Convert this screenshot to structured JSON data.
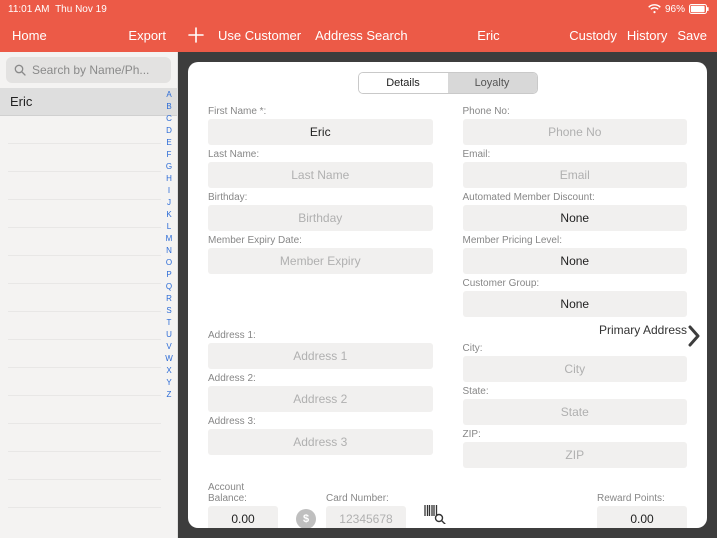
{
  "status": {
    "time": "11:01 AM",
    "date": "Thu Nov 19",
    "battery": "96%"
  },
  "toolbar": {
    "home": "Home",
    "export": "Export",
    "use_customer": "Use Customer",
    "address_search": "Address Search",
    "title": "Eric",
    "custody": "Custody",
    "history": "History",
    "save": "Save"
  },
  "sidebar": {
    "search_placeholder": "Search by Name/Ph...",
    "items": [
      "Eric"
    ],
    "az": [
      "A",
      "B",
      "C",
      "D",
      "E",
      "F",
      "G",
      "H",
      "I",
      "J",
      "K",
      "L",
      "M",
      "N",
      "O",
      "P",
      "Q",
      "R",
      "S",
      "T",
      "U",
      "V",
      "W",
      "X",
      "Y",
      "Z"
    ]
  },
  "tabs": {
    "details": "Details",
    "loyalty": "Loyalty"
  },
  "labels": {
    "first_name": "First Name *:",
    "last_name": "Last Name:",
    "birthday": "Birthday:",
    "member_expiry": "Member Expiry Date:",
    "phone": "Phone No:",
    "email": "Email:",
    "auto_discount": "Automated Member Discount:",
    "pricing_level": "Member Pricing Level:",
    "customer_group": "Customer Group:",
    "primary_address": "Primary Address",
    "address1": "Address 1:",
    "address2": "Address 2:",
    "address3": "Address 3:",
    "city": "City:",
    "state": "State:",
    "zip": "ZIP:",
    "account_balance": "Account Balance:",
    "card_number": "Card Number:",
    "reward_points": "Reward Points:"
  },
  "values": {
    "first_name": "Eric",
    "auto_discount": "None",
    "pricing_level": "None",
    "customer_group": "None",
    "account_balance": "0.00",
    "reward_points": "0.00"
  },
  "placeholders": {
    "last_name": "Last Name",
    "birthday": "Birthday",
    "member_expiry": "Member Expiry",
    "phone": "Phone No",
    "email": "Email",
    "address1": "Address 1",
    "address2": "Address 2",
    "address3": "Address 3",
    "city": "City",
    "state": "State",
    "zip": "ZIP",
    "card_number": "12345678"
  }
}
